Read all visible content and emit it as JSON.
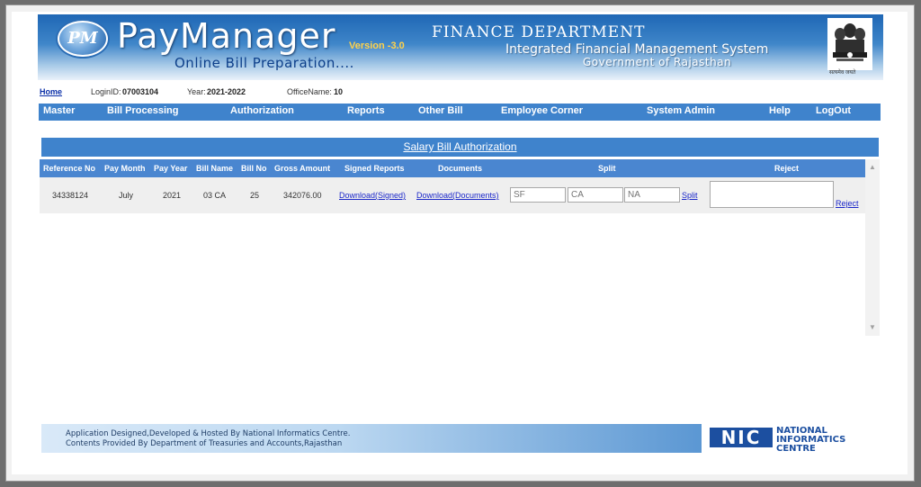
{
  "header": {
    "logo_text": "PM",
    "brand_title": "PayManager",
    "version": "Version -3.0",
    "subtitle": "Online Bill Preparation....",
    "dept_title": "FINANCE  DEPARTMENT",
    "dept_system": "Integrated Financial Management System",
    "dept_gov": "Government of Rajasthan",
    "emblem_caption": "सत्यमेव जयते"
  },
  "info": {
    "home": "Home",
    "login_label": "LoginID:",
    "login_value": "07003104",
    "year_label": "Year:",
    "year_value": "2021-2022",
    "office_label": "OfficeName:",
    "office_value": "10"
  },
  "nav": {
    "items": [
      "Master",
      "Bill Processing",
      "Authorization",
      "Reports",
      "Other Bill",
      "Employee Corner",
      "System Admin",
      "Help",
      "LogOut"
    ]
  },
  "auth": {
    "title": "Salary Bill Authorization",
    "columns": [
      "Reference No",
      "Pay Month",
      "Pay Year",
      "Bill Name",
      "Bill No",
      "Gross Amount",
      "Signed Reports",
      "Documents",
      "Split",
      "Reject"
    ],
    "rows": [
      {
        "reference_no": "34338124",
        "pay_month": "July",
        "pay_year": "2021",
        "bill_name": "03 CA",
        "bill_no": "25",
        "gross_amount": "342076.00",
        "signed_reports": "Download(Signed)",
        "documents": "Download(Documents)",
        "split_placeholders": [
          "SF",
          "CA",
          "NA"
        ],
        "split_link": "Split",
        "reject_link": "Reject"
      }
    ]
  },
  "footer": {
    "line1": "Application Designed,Developed & Hosted By National Informatics Centre.",
    "line2": "Contents Provided By Department of  Treasuries and Accounts,Rajasthan",
    "nic_logo": "NIC",
    "nic_line1": "NATIONAL",
    "nic_line2": "INFORMATICS",
    "nic_line3": "CENTRE"
  },
  "colors": {
    "nav_bg": "#3f83cc",
    "grid_header": "#4a86d0",
    "link": "#1b27c9"
  }
}
